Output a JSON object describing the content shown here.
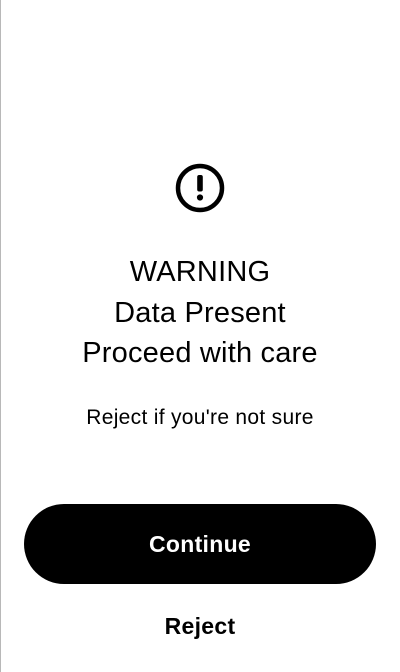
{
  "screen": {
    "icon": "exclamation-circle-icon",
    "headline": {
      "line1": "WARNING",
      "line2": "Data Present",
      "line3": "Proceed with care"
    },
    "subtext": "Reject if you're not sure"
  },
  "actions": {
    "continue_label": "Continue",
    "reject_label": "Reject"
  },
  "colors": {
    "background": "#ffffff",
    "text": "#000000",
    "primary_button_bg": "#000000",
    "primary_button_text": "#ffffff"
  }
}
